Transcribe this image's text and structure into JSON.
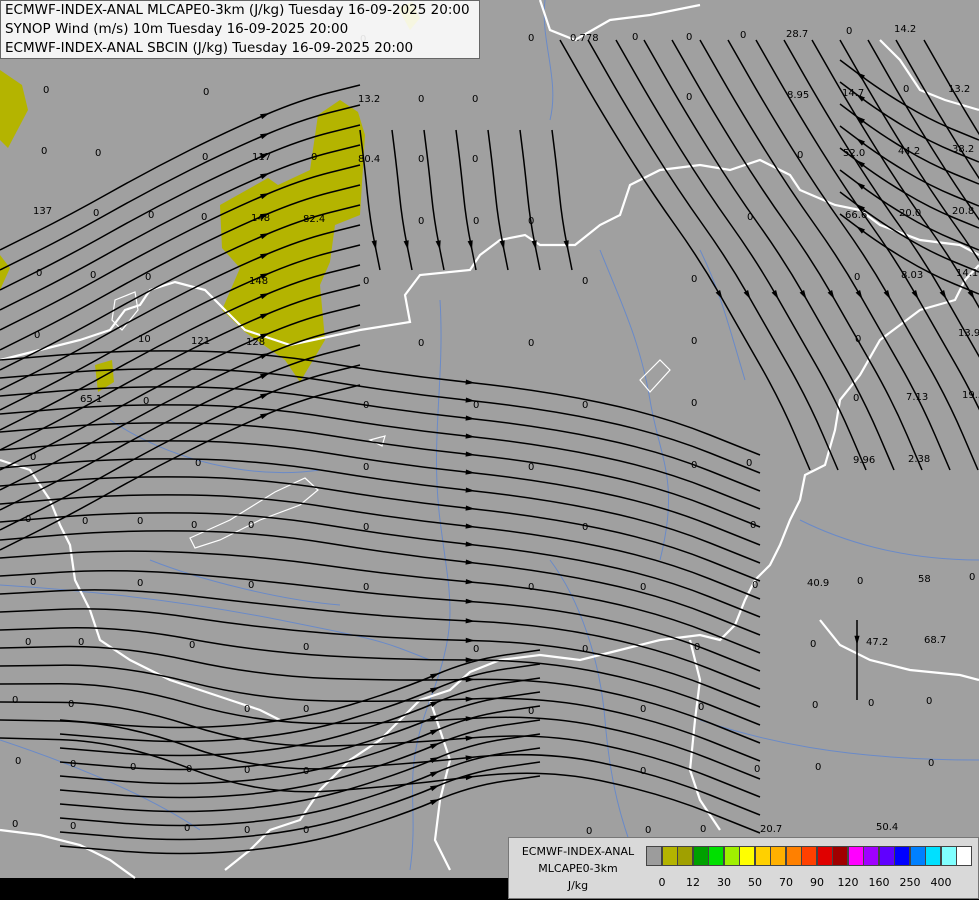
{
  "title_lines": [
    "ECMWF-INDEX-ANAL MLCAPE0-3km (J/kg) Tuesday 16-09-2025 20:00",
    "SYNOP Wind (m/s) 10m Tuesday 16-09-2025 20:00",
    "ECMWF-INDEX-ANAL SBCIN (J/kg) Tuesday 16-09-2025 20:00"
  ],
  "legend": {
    "title": [
      "ECMWF-INDEX-ANAL",
      "MLCAPE0-3km",
      "J/kg"
    ],
    "colors": [
      "#9c9c9c",
      "#b4b400",
      "#a0a000",
      "#00a000",
      "#00e000",
      "#a0f000",
      "#ffff00",
      "#ffd000",
      "#ffb000",
      "#ff8000",
      "#ff4000",
      "#e00000",
      "#a00000",
      "#ff00ff",
      "#a000ff",
      "#6000ff",
      "#0000ff",
      "#0080ff",
      "#00e0ff",
      "#80ffff",
      "#ffffff"
    ],
    "ticks": [
      "0",
      "12",
      "30",
      "50",
      "70",
      "90",
      "120",
      "160",
      "250",
      "400"
    ]
  },
  "colors": {
    "background": "#a0a0a0",
    "cape_low": "#b4b400",
    "streamline": "#000000",
    "border": "#ffffff",
    "river": "#6a8ac8"
  },
  "values": [
    "0",
    "0.778",
    "0",
    "0",
    "0",
    "28.7",
    "0",
    "14.2",
    "0",
    "0",
    "13.2",
    "0",
    "0",
    "0",
    "8.95",
    "14.7",
    "0",
    "13.2",
    "0",
    "0",
    "0",
    "117",
    "0",
    "80.4",
    "0",
    "0",
    "0",
    "52.0",
    "44.2",
    "38.2",
    "137",
    "0",
    "0",
    "0",
    "148",
    "82.4",
    "0",
    "0",
    "0",
    "0",
    "66.6",
    "20.0",
    "20.8",
    "0",
    "0",
    "0",
    "148",
    "0",
    "0",
    "0",
    "0",
    "8.03",
    "14.1",
    "0",
    "10",
    "121",
    "128",
    "0",
    "0",
    "0",
    "0",
    "13.9",
    "65.1",
    "0",
    "0",
    "0",
    "0",
    "0",
    "0",
    "7.13",
    "19.5",
    "0",
    "0",
    "0",
    "0",
    "0",
    "0",
    "9.96",
    "2.38",
    "0",
    "0",
    "0",
    "0",
    "0",
    "0",
    "0",
    "0",
    "0",
    "0",
    "0",
    "0",
    "0",
    "0",
    "0",
    "40.9",
    "0",
    "58",
    "0",
    "0",
    "0",
    "0",
    "0",
    "0",
    "0",
    "0",
    "0",
    "47.2",
    "68.7",
    "0",
    "0",
    "0",
    "0",
    "0",
    "0",
    "0",
    "0",
    "0",
    "0",
    "0",
    "0",
    "0",
    "0",
    "0",
    "0",
    "0",
    "0",
    "0",
    "0",
    "0",
    "0",
    "0",
    "0",
    "0",
    "0",
    "0",
    "0",
    "20.7",
    "50.4",
    "0"
  ]
}
